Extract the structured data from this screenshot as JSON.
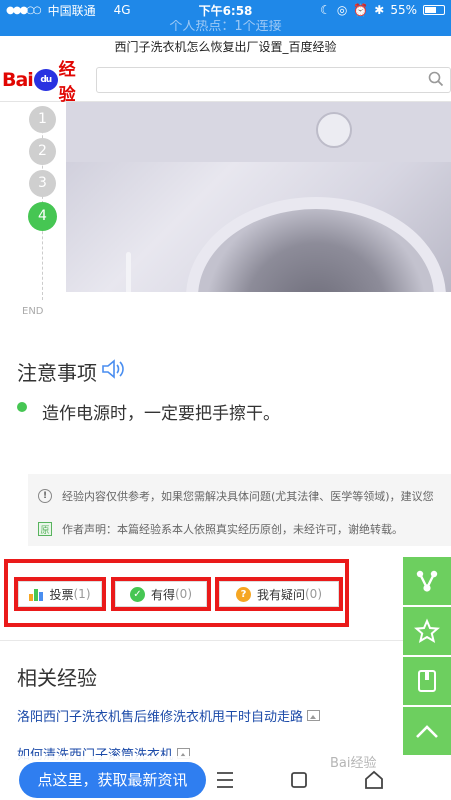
{
  "status_bar": {
    "carrier": "中国联通",
    "network": "4G",
    "time": "下午6:58",
    "battery": "55%"
  },
  "hotspot_banner": "个人热点：1个连接",
  "page_title": "西门子洗衣机怎么恢复出厂设置_百度经验",
  "header": {
    "logo_bai": "Bai",
    "logo_du": "du",
    "logo_jingyan": "经验",
    "search_placeholder": ""
  },
  "steps": {
    "items": [
      "1",
      "2",
      "3",
      "4"
    ],
    "active": "4",
    "end_label": "END"
  },
  "notes": {
    "title": "注意事项",
    "items": [
      "造作电源时，一定要把手擦干。"
    ]
  },
  "disclaimer": {
    "line1": "经验内容仅供参考，如果您需解决具体问题(尤其法律、医学等领域)，建议您",
    "line2_icon": "原",
    "line2": "作者声明：本篇经验系本人依照真实经历原创，未经许可，谢绝转载。"
  },
  "actions": {
    "vote_label": "投票",
    "vote_count": "(1)",
    "useful_label": "有得",
    "useful_count": "(0)",
    "question_label": "我有疑问",
    "question_count": "(0)"
  },
  "related": {
    "title": "相关经验",
    "items": [
      "洛阳西门子洗衣机售后维修洗衣机甩干时自动走路",
      "如何清洗西门子滚筒洗衣机"
    ]
  },
  "bottom_bar": {
    "cta_label": "点这里，获取最新资讯",
    "watermark": "Bai经验"
  },
  "icons": {
    "share": "share-icon",
    "favorite": "star-icon",
    "bookmark": "book-icon",
    "top": "chevron-up-icon",
    "menu": "menu-icon",
    "tabs": "tabs-icon",
    "home": "home-icon"
  },
  "colors": {
    "status_blue": "#1f88e8",
    "accent_green": "#46c653",
    "highlight_red": "#ea1a1a",
    "cta_blue": "#2f7ef0"
  }
}
